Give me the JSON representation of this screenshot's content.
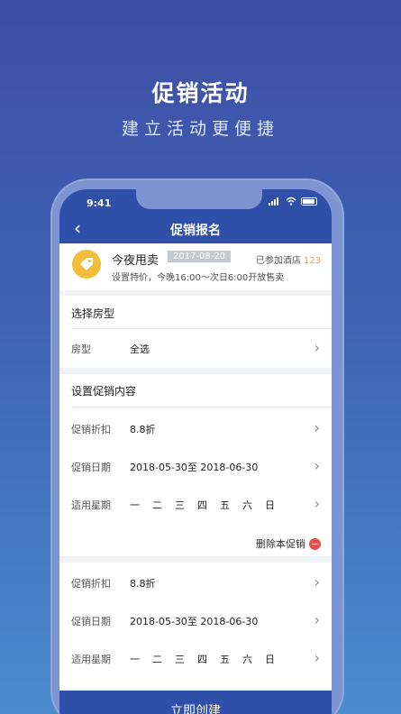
{
  "hero": {
    "title": "促销活动",
    "subtitle": "建立活动更便捷"
  },
  "statusbar": {
    "time": "9:41"
  },
  "nav": {
    "back": "‹",
    "title": "促销报名"
  },
  "promo": {
    "name": "今夜甩卖",
    "date": "2017-08-20",
    "joined_label": "已参加酒店",
    "joined_count": "123",
    "desc": "设置特价，今晚16:00～次日6:00开放售卖"
  },
  "room_section": {
    "title": "选择房型",
    "room_label": "房型",
    "room_value": "全选"
  },
  "content_section": {
    "title": "设置促销内容",
    "discount_label": "促销折扣",
    "discount_value": "8.8折",
    "date_label": "促销日期",
    "date_value": "2018-05-30至 2018-06-30",
    "weekday_label": "适用星期",
    "weekdays": [
      "一",
      "二",
      "三",
      "四",
      "五",
      "六",
      "日"
    ],
    "delete_label": "删除本促销"
  },
  "content_section2": {
    "discount_label": "促销折扣",
    "discount_value": "8.8折",
    "date_label": "促销日期",
    "date_value": "2018-05-30至 2018-06-30",
    "weekday_label": "适用星期",
    "weekdays": [
      "一",
      "二",
      "三",
      "四",
      "五",
      "六",
      "日"
    ]
  },
  "create_button": "立即创建",
  "colors": {
    "primary": "#2f4fa8",
    "accent": "#f2be3a",
    "danger": "#e84f4f"
  }
}
